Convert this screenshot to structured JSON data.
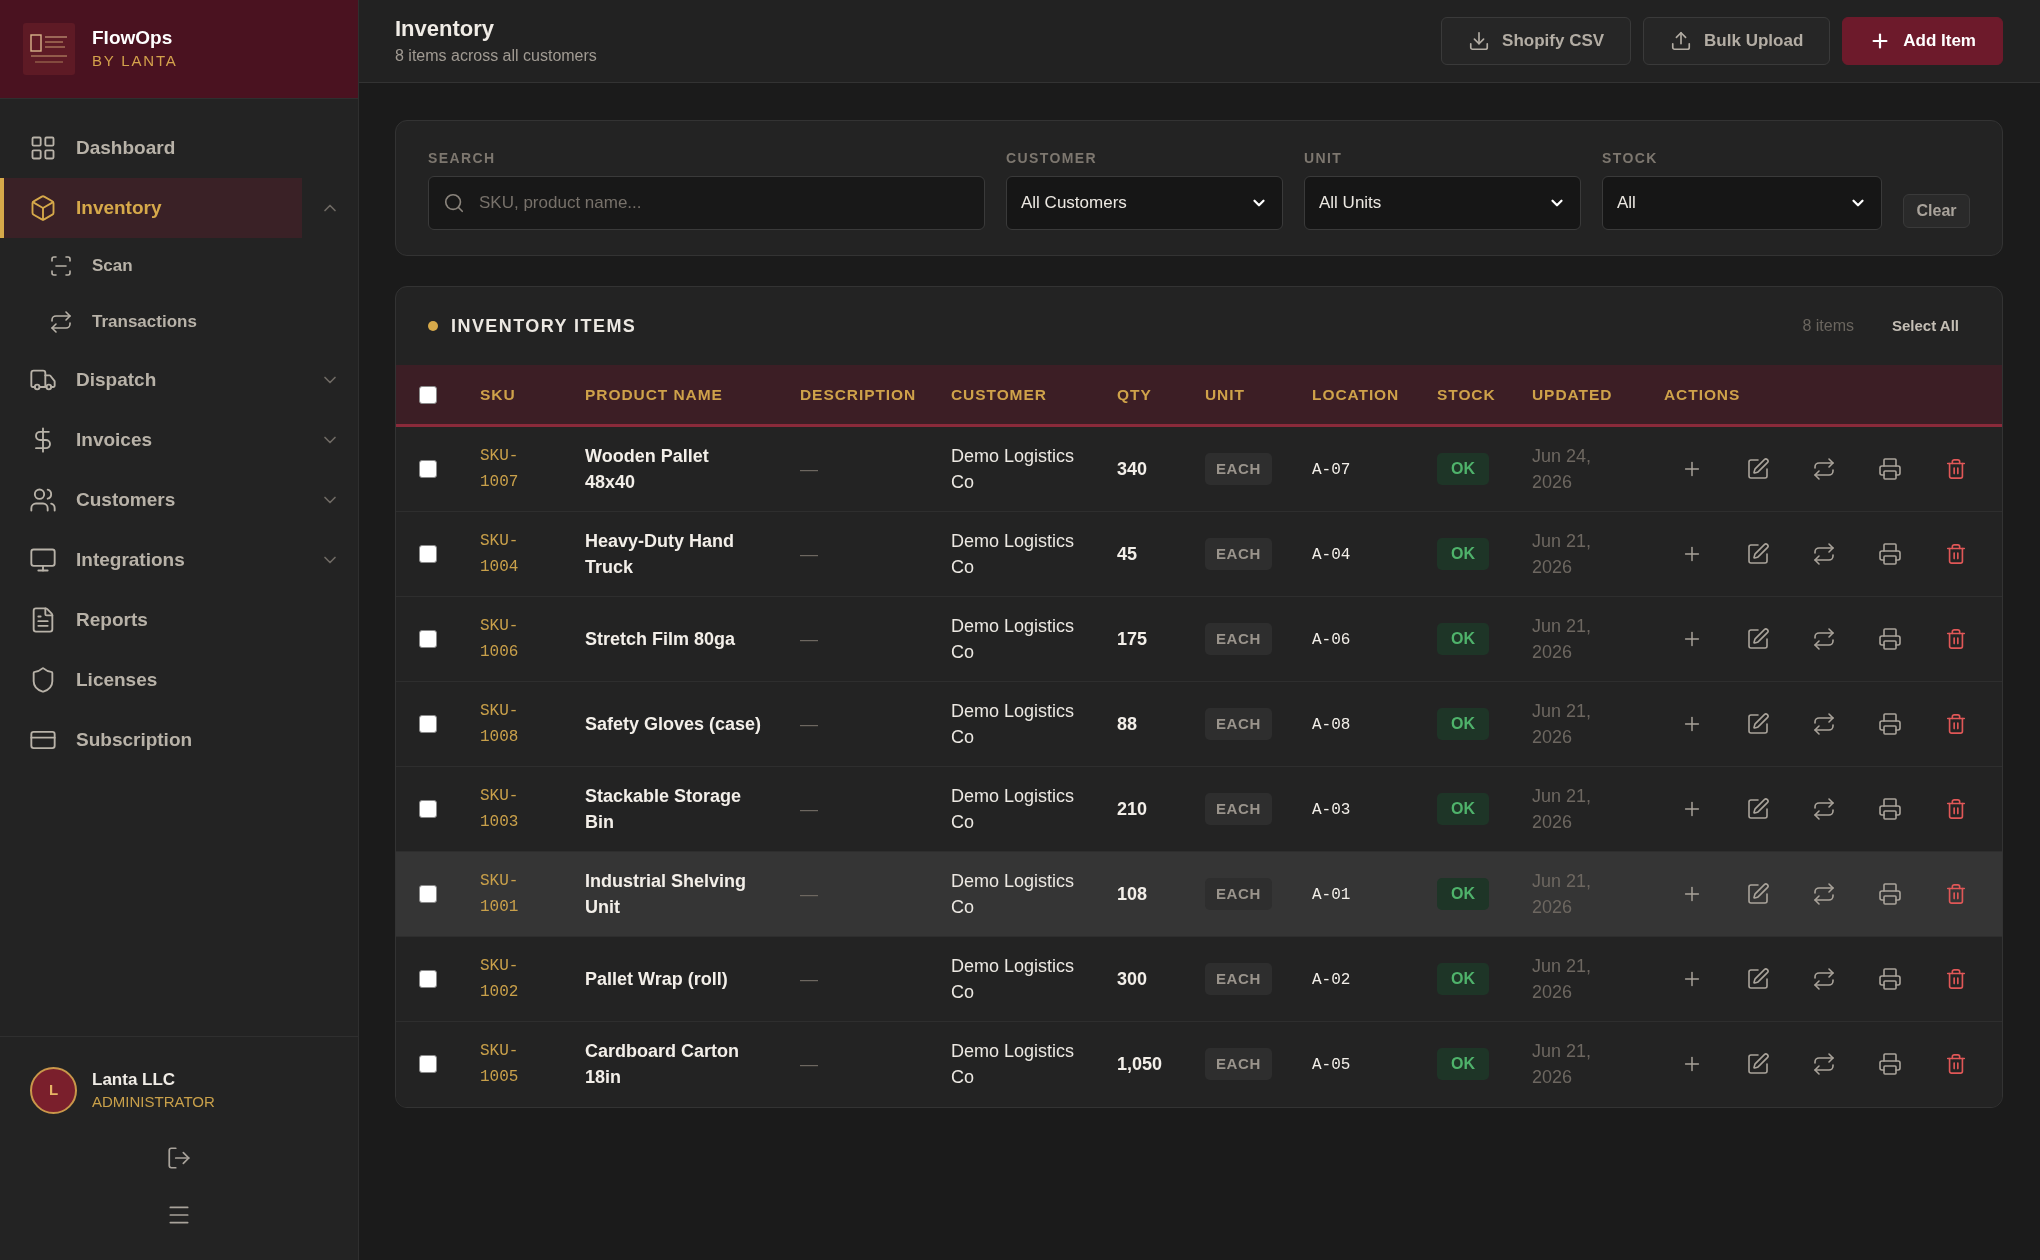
{
  "brand": {
    "name": "FlowOps",
    "tagline": "BY LANTA"
  },
  "sidebar": {
    "items": [
      {
        "label": "Dashboard",
        "selected": false
      },
      {
        "label": "Inventory",
        "selected": true,
        "expanded": true,
        "children": [
          {
            "label": "Scan",
            "selected": false
          },
          {
            "label": "Transactions",
            "selected": false
          }
        ]
      },
      {
        "label": "Dispatch",
        "selected": false,
        "expanded": false
      },
      {
        "label": "Invoices",
        "selected": false,
        "expanded": false
      },
      {
        "label": "Customers",
        "selected": false,
        "expanded": false
      },
      {
        "label": "Integrations",
        "selected": false,
        "expanded": false
      },
      {
        "label": "Reports",
        "selected": false
      },
      {
        "label": "Licenses",
        "selected": false
      },
      {
        "label": "Subscription",
        "selected": false
      }
    ]
  },
  "user": {
    "initial": "L",
    "name": "Lanta LLC",
    "role": "ADMINISTRATOR"
  },
  "header": {
    "title": "Inventory",
    "subtitle": "8 items across all customers",
    "actions": [
      {
        "label": "Shopify CSV",
        "kind": "secondary"
      },
      {
        "label": "Bulk Upload",
        "kind": "secondary"
      },
      {
        "label": "Add Item",
        "kind": "primary"
      }
    ]
  },
  "filters": {
    "search": {
      "label": "SEARCH",
      "placeholder": "SKU, product name..."
    },
    "selects": [
      {
        "label": "CUSTOMER",
        "value": "All Customers"
      },
      {
        "label": "UNIT",
        "value": "All Units"
      },
      {
        "label": "STOCK",
        "value": "All"
      }
    ],
    "clear": "Clear"
  },
  "table": {
    "title": "INVENTORY ITEMS",
    "count": "8 items",
    "select_all": "Select All",
    "all_checked": false,
    "columns": [
      "SKU",
      "PRODUCT NAME",
      "DESCRIPTION",
      "CUSTOMER",
      "QTY",
      "UNIT",
      "LOCATION",
      "STOCK",
      "UPDATED",
      "ACTIONS"
    ],
    "rows": [
      {
        "checked": false,
        "hovered": false,
        "sku": "SKU-1007",
        "name": "Wooden Pallet 48x40",
        "description": "—",
        "customer": "Demo Logistics Co",
        "qty": "340",
        "unit": "EACH",
        "location": "A-07",
        "stock": {
          "label": "OK",
          "kind": "ok"
        },
        "updated": "Jun 24, 2026"
      },
      {
        "checked": false,
        "hovered": false,
        "sku": "SKU-1004",
        "name": "Heavy-Duty Hand Truck",
        "description": "—",
        "customer": "Demo Logistics Co",
        "qty": "45",
        "unit": "EACH",
        "location": "A-04",
        "stock": {
          "label": "OK",
          "kind": "ok"
        },
        "updated": "Jun 21, 2026"
      },
      {
        "checked": false,
        "hovered": false,
        "sku": "SKU-1006",
        "name": "Stretch Film 80ga",
        "description": "—",
        "customer": "Demo Logistics Co",
        "qty": "175",
        "unit": "EACH",
        "location": "A-06",
        "stock": {
          "label": "OK",
          "kind": "ok"
        },
        "updated": "Jun 21, 2026"
      },
      {
        "checked": false,
        "hovered": false,
        "sku": "SKU-1008",
        "name": "Safety Gloves (case)",
        "description": "—",
        "customer": "Demo Logistics Co",
        "qty": "88",
        "unit": "EACH",
        "location": "A-08",
        "stock": {
          "label": "OK",
          "kind": "ok"
        },
        "updated": "Jun 21, 2026"
      },
      {
        "checked": false,
        "hovered": false,
        "sku": "SKU-1003",
        "name": "Stackable Storage Bin",
        "description": "—",
        "customer": "Demo Logistics Co",
        "qty": "210",
        "unit": "EACH",
        "location": "A-03",
        "stock": {
          "label": "OK",
          "kind": "ok"
        },
        "updated": "Jun 21, 2026"
      },
      {
        "checked": false,
        "hovered": true,
        "sku": "SKU-1001",
        "name": "Industrial Shelving Unit",
        "description": "—",
        "customer": "Demo Logistics Co",
        "qty": "108",
        "unit": "EACH",
        "location": "A-01",
        "stock": {
          "label": "OK",
          "kind": "ok"
        },
        "updated": "Jun 21, 2026"
      },
      {
        "checked": false,
        "hovered": false,
        "sku": "SKU-1002",
        "name": "Pallet Wrap (roll)",
        "description": "—",
        "customer": "Demo Logistics Co",
        "qty": "300",
        "unit": "EACH",
        "location": "A-02",
        "stock": {
          "label": "OK",
          "kind": "ok"
        },
        "updated": "Jun 21, 2026"
      },
      {
        "checked": false,
        "hovered": false,
        "sku": "SKU-1005",
        "name": "Cardboard Carton 18in",
        "description": "—",
        "customer": "Demo Logistics Co",
        "qty": "1,050",
        "unit": "EACH",
        "location": "A-05",
        "stock": {
          "label": "OK",
          "kind": "ok"
        },
        "updated": "Jun 21, 2026"
      }
    ]
  }
}
